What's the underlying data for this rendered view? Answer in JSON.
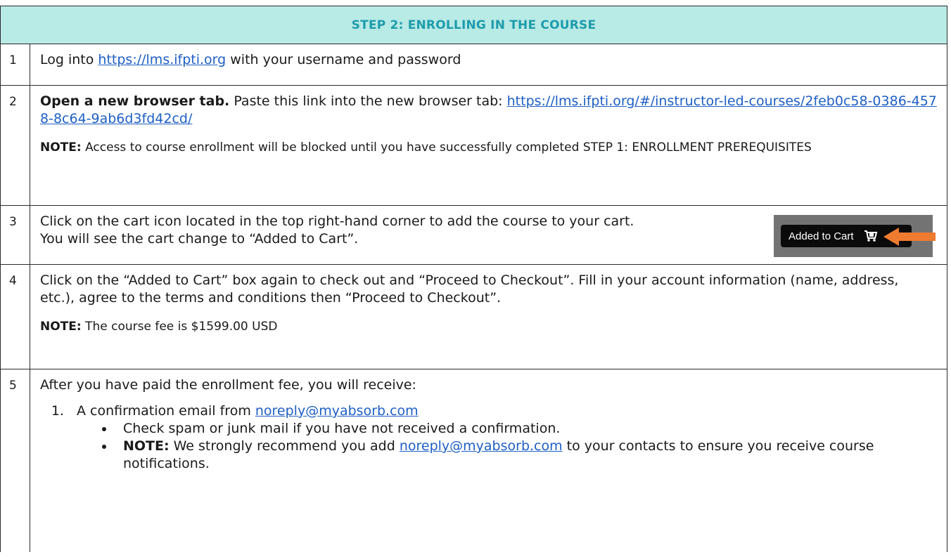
{
  "header": {
    "title": "STEP 2: ENROLLING IN THE COURSE"
  },
  "rows": [
    {
      "number": "1",
      "text_before": "Log into ",
      "link": "https://lms.ifpti.org",
      "text_after": " with your username and password"
    },
    {
      "number": "2",
      "bold_lead": "Open a new browser tab.",
      "text": " Paste this link into the new browser tab: ",
      "link": "https://lms.ifpti.org/#/instructor-led-courses/2feb0c58-0386-4578-8c64-9ab6d3fd42cd/",
      "note_label": "NOTE:",
      "note_text": " Access to course enrollment will be blocked until you have successfully completed STEP 1: ENROLLMENT PREREQUISITES"
    },
    {
      "number": "3",
      "text": "Click on the cart icon located in the top right-hand corner to add the course to your cart. You will see the cart change to “Added to Cart”.",
      "button_label": "Added to Cart",
      "button_icon": "cart-icon",
      "arrow_color": "#ee7b30"
    },
    {
      "number": "4",
      "text": "Click on the “Added to Cart” box again to check out and “Proceed to Checkout”. Fill in your account information (name, address, etc.), agree to the terms and conditions then “Proceed to Checkout”.",
      "note_label": "NOTE:",
      "note_text": " The course fee is $1599.00 USD"
    },
    {
      "number": "5",
      "intro": "After you have paid the enrollment fee, you will receive:",
      "item_1_text": "A confirmation email from ",
      "item_1_link": "noreply@myabsorb.com",
      "bullet_1": "Check spam or junk mail if you have not received a confirmation.",
      "bullet_2_label": "NOTE:",
      "bullet_2_text_a": " We strongly recommend you add ",
      "bullet_2_link": "noreply@myabsorb.com",
      "bullet_2_text_b": " to your contacts to ensure you receive course notifications."
    }
  ],
  "colors": {
    "header_bg": "#b8eae6",
    "header_text": "#1f9cab",
    "link": "#1e5fc4",
    "arrow": "#ee7b30"
  }
}
